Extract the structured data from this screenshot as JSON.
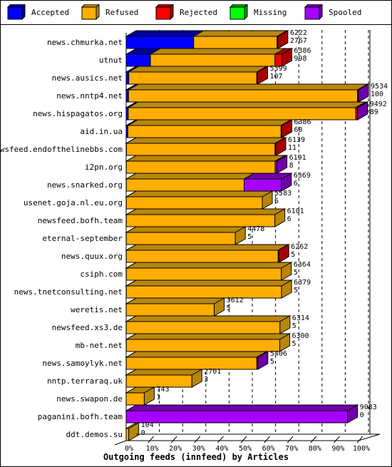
{
  "chart_data": {
    "type": "bar",
    "orientation": "horizontal",
    "stacked": true,
    "three_d": true,
    "title": "",
    "xlabel": "Outgoing feeds (innfeed) by Articles",
    "ylabel": "",
    "xlim": [
      0,
      100
    ],
    "x_ticks": [
      "0%",
      "10%",
      "20%",
      "30%",
      "40%",
      "50%",
      "60%",
      "70%",
      "80%",
      "90%",
      "100%"
    ],
    "grid": true,
    "legend_position": "top",
    "legend": [
      {
        "name": "Accepted",
        "color": "#0000ff",
        "side": "#00009c"
      },
      {
        "name": "Refused",
        "color": "#ffae00",
        "side": "#b8860b"
      },
      {
        "name": "Rejected",
        "color": "#ff0000",
        "side": "#a80000"
      },
      {
        "name": "Missing",
        "color": "#00ff00",
        "side": "#009c00"
      },
      {
        "name": "Spooled",
        "color": "#a600ff",
        "side": "#7000a8"
      }
    ],
    "categories": [
      "news.chmurka.net",
      "utnut",
      "news.ausics.net",
      "news.nntp4.net",
      "news.hispagatos.org",
      "aid.in.ua",
      "newsfeed.endofthelinebbs.com",
      "i2pn.org",
      "news.snarked.org",
      "usenet.goja.nl.eu.org",
      "newsfeed.bofh.team",
      "eternal-september",
      "news.quux.org",
      "csiph.com",
      "news.tnetconsulting.net",
      "weretis.net",
      "newsfeed.xs3.de",
      "mb-net.net",
      "news.samoylyk.net",
      "nntp.terraraq.uk",
      "news.swapon.de",
      "paganini.bofh.team",
      "ddt.demos.su"
    ],
    "label_top": [
      6222,
      6386,
      5399,
      9534,
      9492,
      6386,
      6139,
      6191,
      6369,
      5583,
      6101,
      4478,
      6262,
      6364,
      6379,
      3612,
      6314,
      6300,
      5406,
      2701,
      743,
      9083,
      104
    ],
    "label_bottom": [
      2767,
      998,
      107,
      100,
      89,
      68,
      11,
      8,
      6,
      6,
      6,
      5,
      5,
      5,
      5,
      5,
      5,
      5,
      5,
      3,
      1,
      0,
      0
    ],
    "bar_length_pct": [
      65.3,
      67.0,
      56.6,
      100,
      99.6,
      67.0,
      64.4,
      64.9,
      66.8,
      58.6,
      64.0,
      47.0,
      65.7,
      66.8,
      66.9,
      37.9,
      66.2,
      66.1,
      56.7,
      28.3,
      7.8,
      95.3,
      1.1
    ],
    "series": [
      {
        "name": "Accepted",
        "values_pct_of_bar": [
          44.5,
          15.6,
          2.0,
          1.0,
          0.9,
          1.1,
          0.2,
          0.1,
          0.1,
          0.1,
          0.1,
          0.1,
          0.1,
          0.1,
          0.1,
          0.1,
          0.1,
          0.1,
          0.1,
          0.1,
          0.1,
          0,
          0
        ]
      },
      {
        "name": "Refused",
        "values_pct_of_bar": [
          55.0,
          80.0,
          97.3,
          98.6,
          98.3,
          98.4,
          99.3,
          98.7,
          75.9,
          99.9,
          99.9,
          99.9,
          99.5,
          99.9,
          99.9,
          99.9,
          99.9,
          99.9,
          99.1,
          99.9,
          99.9,
          0,
          100
        ]
      },
      {
        "name": "Rejected",
        "values_pct_of_bar": [
          0.5,
          4.4,
          0.7,
          0.2,
          0.7,
          0.5,
          0.5,
          0,
          0,
          0,
          0,
          0,
          0.4,
          0,
          0,
          0,
          0,
          0,
          0,
          0,
          0,
          0,
          0
        ]
      },
      {
        "name": "Missing",
        "values_pct_of_bar": [
          0,
          0,
          0,
          0,
          0,
          0,
          0,
          0,
          0,
          0,
          0,
          0,
          0,
          0,
          0,
          0,
          0,
          0,
          0,
          0,
          0,
          0,
          0
        ]
      },
      {
        "name": "Spooled",
        "values_pct_of_bar": [
          0,
          0,
          0,
          0.2,
          0.1,
          0,
          0,
          1.2,
          24.0,
          0,
          0,
          0,
          0,
          0,
          0,
          0,
          0,
          0,
          0.8,
          0,
          0,
          100,
          0
        ]
      }
    ],
    "end_cap_color": [
      "#a80000",
      "#a80000",
      "#a80000",
      "#7000a8",
      "#7000a8",
      "#a80000",
      "#a80000",
      "#7000a8",
      "#7000a8",
      "#b8860b",
      "#b8860b",
      "#b8860b",
      "#a80000",
      "#b8860b",
      "#b8860b",
      "#b8860b",
      "#b8860b",
      "#b8860b",
      "#7000a8",
      "#b8860b",
      "#b8860b",
      "#7000a8",
      "#b8860b"
    ]
  }
}
